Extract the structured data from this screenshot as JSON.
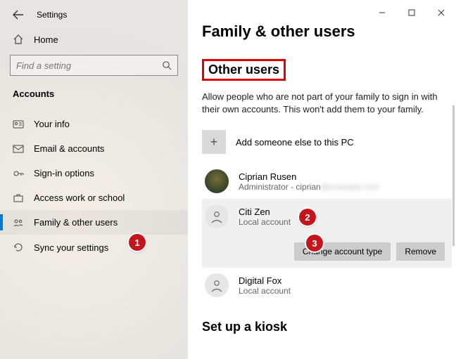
{
  "window": {
    "title": "Settings"
  },
  "sidebar": {
    "home": "Home",
    "search_placeholder": "Find a setting",
    "category": "Accounts",
    "items": [
      {
        "label": "Your info"
      },
      {
        "label": "Email & accounts"
      },
      {
        "label": "Sign-in options"
      },
      {
        "label": "Access work or school"
      },
      {
        "label": "Family & other users"
      },
      {
        "label": "Sync your settings"
      }
    ],
    "selected_index": 4
  },
  "page": {
    "title": "Family & other users",
    "section_title": "Other users",
    "section_desc": "Allow people who are not part of your family to sign in with their own accounts. This won't add them to your family.",
    "add_label": "Add someone else to this PC",
    "users": [
      {
        "name": "Ciprian Rusen",
        "sub_prefix": "Administrator - ",
        "sub_value": "ciprian",
        "has_photo": true
      },
      {
        "name": "Citi Zen",
        "sub": "Local account",
        "expanded": true
      },
      {
        "name": "Digital Fox",
        "sub": "Local account"
      }
    ],
    "actions": {
      "change": "Change account type",
      "remove": "Remove"
    },
    "kiosk_title": "Set up a kiosk"
  },
  "callouts": {
    "1": "1",
    "2": "2",
    "3": "3"
  }
}
